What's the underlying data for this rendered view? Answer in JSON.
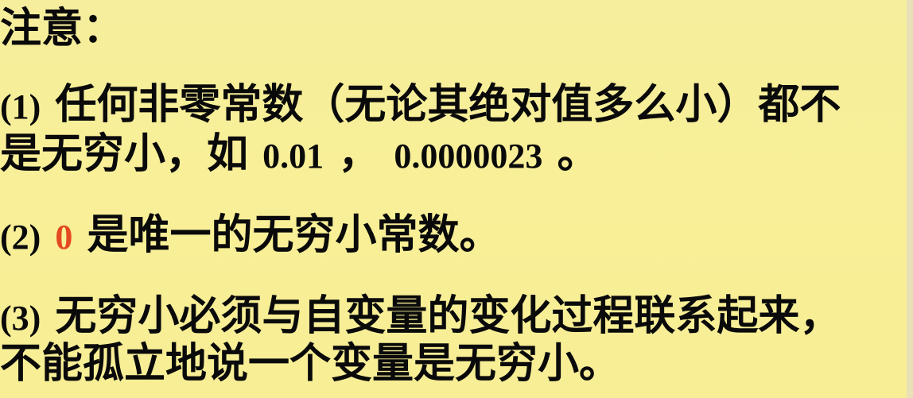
{
  "heading": "注意：",
  "items": [
    {
      "marker": "(1)",
      "line1": "任何非零常数（无论其绝对值多么小）都不",
      "line2_prefix": "是无穷小，如 ",
      "example1": "0.01",
      "sep": "，",
      "example2": "0.0000023",
      "end": "。"
    },
    {
      "marker": "(2)",
      "highlight": "0",
      "rest": "是唯一的无穷小常数。"
    },
    {
      "marker": "(3)",
      "line1": "无穷小必须与自变量的变化过程联系起来，",
      "line2": "不能孤立地说一个变量是无穷小。"
    }
  ],
  "colors": {
    "background": "#f7ee9a",
    "text": "#0a0a0a",
    "highlight": "#e4491f"
  }
}
